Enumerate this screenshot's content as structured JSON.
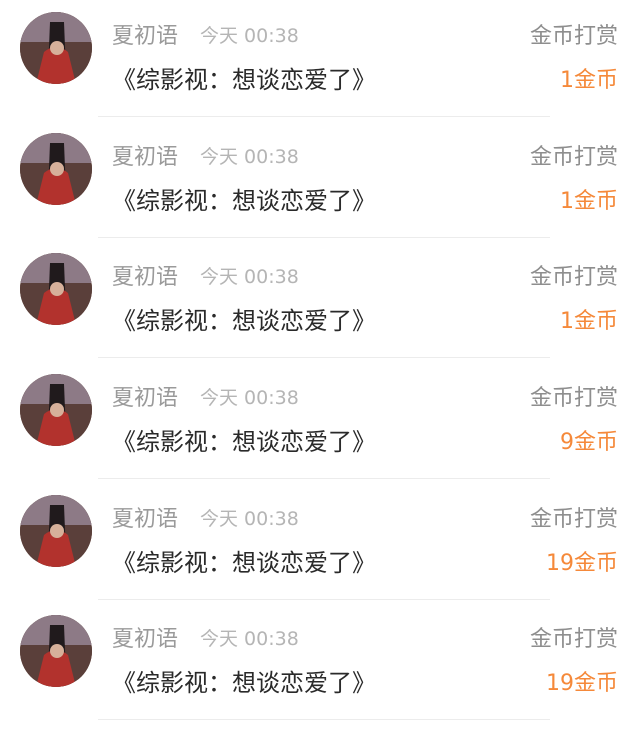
{
  "records": [
    {
      "name": "夏初语",
      "time": "今天 00:38",
      "type": "金币打赏",
      "book": "《综影视：想谈恋爱了》",
      "amount": "1金币"
    },
    {
      "name": "夏初语",
      "time": "今天 00:38",
      "type": "金币打赏",
      "book": "《综影视：想谈恋爱了》",
      "amount": "1金币"
    },
    {
      "name": "夏初语",
      "time": "今天 00:38",
      "type": "金币打赏",
      "book": "《综影视：想谈恋爱了》",
      "amount": "1金币"
    },
    {
      "name": "夏初语",
      "time": "今天 00:38",
      "type": "金币打赏",
      "book": "《综影视：想谈恋爱了》",
      "amount": "9金币"
    },
    {
      "name": "夏初语",
      "time": "今天 00:38",
      "type": "金币打赏",
      "book": "《综影视：想谈恋爱了》",
      "amount": "19金币"
    },
    {
      "name": "夏初语",
      "time": "今天 00:38",
      "type": "金币打赏",
      "book": "《综影视：想谈恋爱了》",
      "amount": "19金币"
    }
  ],
  "colors": {
    "amount": "#f5893a",
    "name": "#9a9a9a",
    "time": "#b5b5b5",
    "title": "#2a2a2a",
    "divider": "#ececec"
  },
  "icons": {
    "avatar": "user-avatar-photo"
  }
}
